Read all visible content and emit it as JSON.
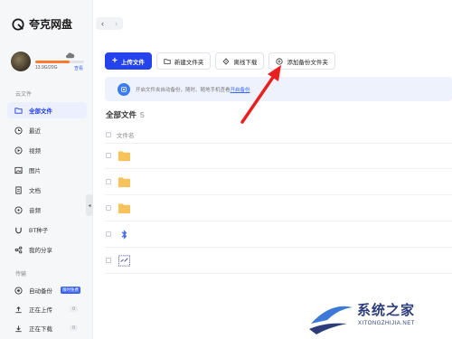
{
  "app": {
    "name": "夸克网盘"
  },
  "user": {
    "storage_text": "13.9G/20G",
    "storage_link": "查看",
    "storage_used_fraction": 0.695
  },
  "sidebar": {
    "cloud_section": "云文件",
    "items": [
      {
        "label": "全部文件",
        "icon": "folder-icon",
        "active": true
      },
      {
        "label": "最近",
        "icon": "clock-icon"
      },
      {
        "label": "视频",
        "icon": "video-icon"
      },
      {
        "label": "图片",
        "icon": "image-icon"
      },
      {
        "label": "文档",
        "icon": "document-icon"
      },
      {
        "label": "音频",
        "icon": "music-icon"
      },
      {
        "label": "BT种子",
        "icon": "magnet-icon"
      },
      {
        "label": "我的分享",
        "icon": "share-icon"
      }
    ],
    "transfer_section": "传输",
    "transfer_items": [
      {
        "label": "自动备份",
        "icon": "backup-icon",
        "badge": "限时免费"
      },
      {
        "label": "正在上传",
        "icon": "upload-icon",
        "count": "0"
      },
      {
        "label": "正在下载",
        "icon": "download-icon",
        "count": "0"
      }
    ]
  },
  "toolbar": {
    "upload": "上传文件",
    "new_folder": "新建文件夹",
    "offline_download": "离线下载",
    "add_backup_folder": "添加备份文件夹"
  },
  "banner": {
    "text": "开启文件夹自动备份，随时、随地手机查看",
    "link": "开启备份"
  },
  "breadcrumb": {
    "title": "全部文件",
    "count": "5"
  },
  "file_list": {
    "column_name": "文件名",
    "rows": [
      {
        "type": "folder"
      },
      {
        "type": "folder"
      },
      {
        "type": "folder"
      },
      {
        "type": "bluetooth-file"
      },
      {
        "type": "image-file"
      }
    ]
  },
  "watermark": {
    "title": "系统之家",
    "url": "XITONGZHIJIA.NET"
  },
  "colors": {
    "accent": "#2443ec",
    "annotation": "#e8201f",
    "folder": "#f7c35a"
  }
}
